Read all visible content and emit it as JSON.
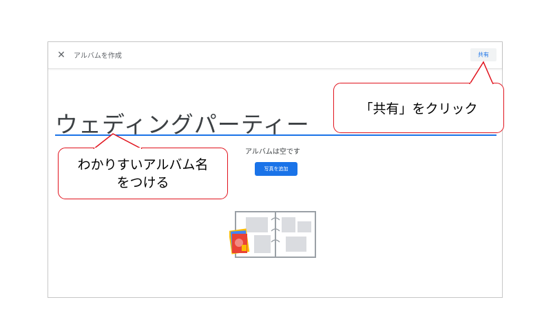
{
  "topbar": {
    "close_icon": "close-icon",
    "title": "アルバムを作成",
    "share_label": "共有"
  },
  "album": {
    "title": "ウェディングパーティー",
    "empty_message": "アルバムは空です",
    "add_photo_label": "写真を追加"
  },
  "annotations": {
    "share_tip": "「共有」をクリック",
    "name_tip_line1": "わかりすいアルバム名",
    "name_tip_line2": "をつける"
  },
  "colors": {
    "accent": "#1a73e8",
    "callout_border": "#e0111b"
  }
}
